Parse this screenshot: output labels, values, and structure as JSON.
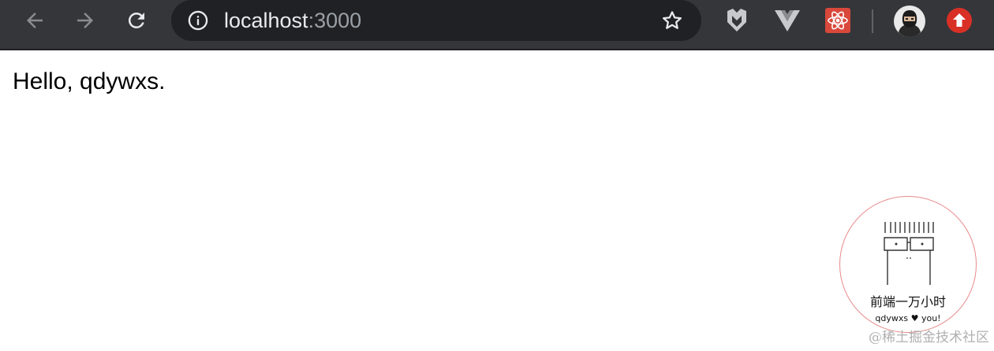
{
  "browser": {
    "url_host": "localhost",
    "url_port": ":3000",
    "icons": [
      "back-arrow-icon",
      "forward-arrow-icon",
      "reload-icon",
      "info-icon",
      "bookmark-star-icon",
      "shield-extension-icon",
      "vue-devtools-icon",
      "react-devtools-icon",
      "profile-avatar-icon",
      "update-icon"
    ]
  },
  "page": {
    "greeting": "Hello, qdywxs."
  },
  "badge": {
    "title": "前端一万小时",
    "subtitle": "qdywxs ♥ you!"
  },
  "watermark": "@稀土掘金技术社区"
}
